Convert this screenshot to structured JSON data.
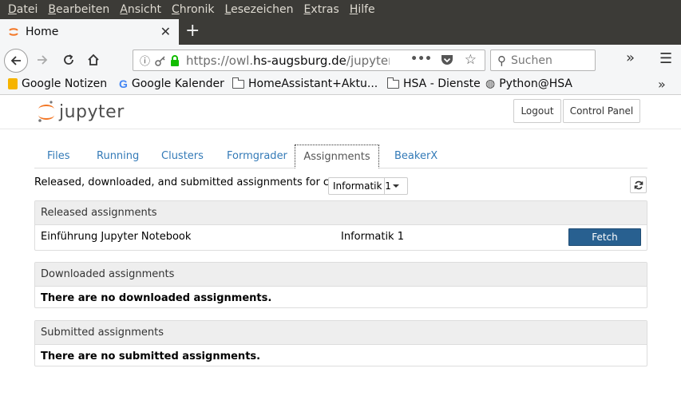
{
  "menubar": {
    "items": [
      "Datei",
      "Bearbeiten",
      "Ansicht",
      "Chronik",
      "Lesezeichen",
      "Extras",
      "Hilfe"
    ]
  },
  "browser": {
    "tab_title": "Home",
    "url_prefix": "https://owl.",
    "url_domain": "hs-augsburg.de",
    "url_path": "/jupyter/u",
    "search_placeholder": "Suchen",
    "icons": {
      "back": "back-arrow-icon",
      "forward": "forward-arrow-icon",
      "reload": "reload-icon",
      "home": "home-icon"
    }
  },
  "bookmarks": [
    {
      "label": "Google Notizen",
      "icon": "keep-icon"
    },
    {
      "label": "Google Kalender",
      "icon": "google-icon"
    },
    {
      "label": "HomeAssistant+Aktu...",
      "icon": "folder-icon"
    },
    {
      "label": "HSA - Dienste",
      "icon": "folder-icon"
    },
    {
      "label": "Python@HSA",
      "icon": "globe-icon"
    }
  ],
  "jupyter": {
    "logo_text": "jupyter",
    "logout_label": "Logout",
    "control_panel_label": "Control Panel",
    "tabs": [
      "Files",
      "Running",
      "Clusters",
      "Formgrader",
      "Assignments",
      "BeakerX"
    ],
    "active_tab": "Assignments",
    "course_label": "Released, downloaded, and submitted assignments for course:",
    "course_selected": "Informatik 1",
    "released": {
      "title": "Released assignments",
      "rows": [
        {
          "name": "Einführung Jupyter Notebook",
          "course": "Informatik 1",
          "action": "Fetch"
        }
      ]
    },
    "downloaded": {
      "title": "Downloaded assignments",
      "empty": "There are no downloaded assignments."
    },
    "submitted": {
      "title": "Submitted assignments",
      "empty": "There are no submitted assignments."
    }
  },
  "colors": {
    "accent": "#286090",
    "link": "#337ab7",
    "jupyter_orange": "#f37726",
    "chrome_dark": "#3c3b37"
  }
}
